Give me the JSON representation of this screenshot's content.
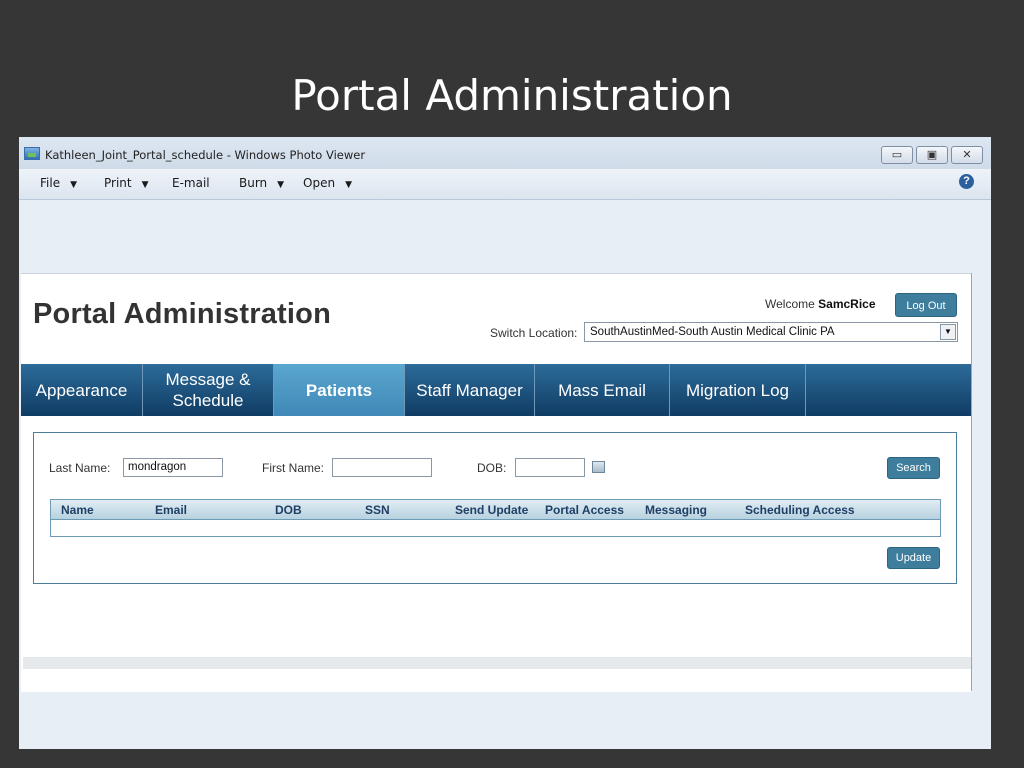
{
  "slide": {
    "title": "Portal Administration"
  },
  "window": {
    "title": "Kathleen_Joint_Portal_schedule - Windows Photo Viewer",
    "controls": {
      "minimize": "▭",
      "maximize": "▣",
      "close": "✕"
    },
    "menu": [
      {
        "label": "File",
        "caret": "▼"
      },
      {
        "label": "Print",
        "caret": "▼"
      },
      {
        "label": "E-mail",
        "caret": ""
      },
      {
        "label": "Burn",
        "caret": "▼"
      },
      {
        "label": "Open",
        "caret": "▼"
      }
    ],
    "help": "?"
  },
  "portal": {
    "title": "Portal Administration",
    "welcome_prefix": "Welcome ",
    "username": "SamcRice",
    "logout_label": "Log Out",
    "switch_location_label": "Switch Location:",
    "location_value": "SouthAustinMed-South Austin Medical Clinic PA",
    "select_arrow": "▼",
    "tabs": [
      {
        "label": "Appearance"
      },
      {
        "label": "Message & Schedule"
      },
      {
        "label": "Patients",
        "active": true
      },
      {
        "label": "Staff Manager"
      },
      {
        "label": "Mass Email"
      },
      {
        "label": "Migration Log"
      }
    ],
    "search": {
      "last_name_label": "Last Name:",
      "last_name_value": "mondragon",
      "first_name_label": "First Name:",
      "first_name_value": "",
      "dob_label": "DOB:",
      "dob_value": "",
      "search_label": "Search"
    },
    "results": {
      "columns": [
        "Name",
        "Email",
        "DOB",
        "SSN",
        "Send Update",
        "Portal Access",
        "Messaging",
        "Scheduling Access"
      ]
    },
    "update_label": "Update"
  },
  "colors": {
    "slide_background": "#363636",
    "nav_dark": "#0f3c63",
    "nav_active": "#4a95c2",
    "button_teal": "#3e7e9c",
    "header_text": "#1f3f66"
  }
}
